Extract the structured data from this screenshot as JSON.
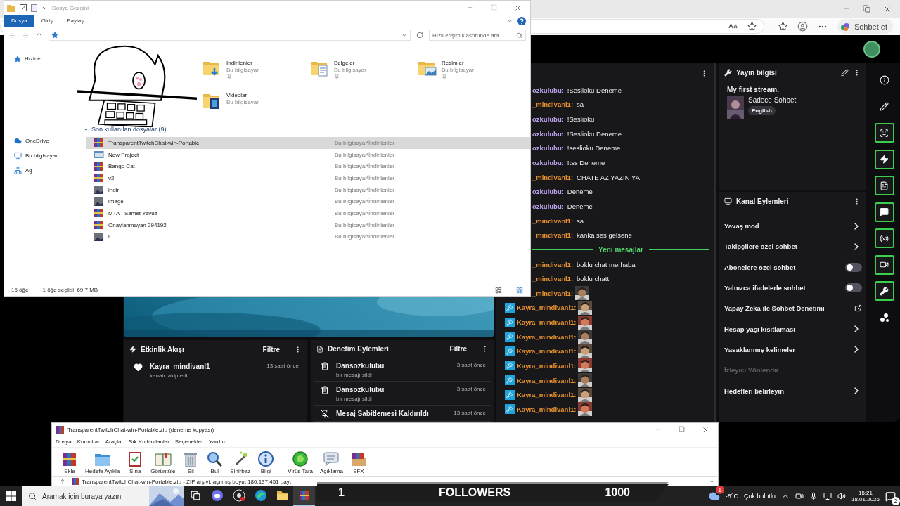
{
  "browser": {
    "copilot_button": "Sohbet et"
  },
  "twitch": {
    "chat": {
      "messages": [
        {
          "kind": "text",
          "badge": false,
          "user": "ozkulubu:",
          "text": "!Seslioku Deneme",
          "color": "#b8a0e8"
        },
        {
          "kind": "text",
          "badge": false,
          "user": "_mindivanl1:",
          "text": "sa",
          "color": "#e8912e"
        },
        {
          "kind": "text",
          "badge": false,
          "user": "ozkulubu:",
          "text": "!Seslioku",
          "color": "#b8a0e8"
        },
        {
          "kind": "text",
          "badge": false,
          "user": "ozkulubu:",
          "text": "!Seslioku Deneme",
          "color": "#b8a0e8"
        },
        {
          "kind": "text",
          "badge": false,
          "user": "ozkulubu:",
          "text": "!seslioku Deneme",
          "color": "#b8a0e8"
        },
        {
          "kind": "text",
          "badge": false,
          "user": "ozkulubu:",
          "text": "!tss Deneme",
          "color": "#b8a0e8"
        },
        {
          "kind": "text",
          "badge": false,
          "user": "_mindivanl1:",
          "text": "CHATE AZ YAZIN YA",
          "color": "#e8912e"
        },
        {
          "kind": "text",
          "badge": false,
          "user": "ozkulubu:",
          "text": "Deneme",
          "color": "#b8a0e8"
        },
        {
          "kind": "text",
          "badge": false,
          "user": "ozkulubu:",
          "text": "Deneme",
          "color": "#b8a0e8"
        },
        {
          "kind": "text",
          "badge": false,
          "user": "_mindivanl1:",
          "text": "sa",
          "color": "#e8912e"
        },
        {
          "kind": "text",
          "badge": false,
          "user": "_mindivanl1:",
          "text": "kanka ses gelsene",
          "color": "#e8912e"
        },
        {
          "kind": "divider",
          "text": "Yeni mesajlar"
        },
        {
          "kind": "text",
          "badge": false,
          "user": "_mindivanl1:",
          "text": "boklu chat merhaba",
          "color": "#e8912e"
        },
        {
          "kind": "text",
          "badge": false,
          "user": "_mindivanl1:",
          "text": "boklu chatt",
          "color": "#e8912e"
        },
        {
          "kind": "emote",
          "badge": false,
          "user": "_mindivanl1:",
          "color": "#e8912e"
        },
        {
          "kind": "emote",
          "badge": true,
          "user": "Kayra_mindivanl1:",
          "color": "#e8912e"
        },
        {
          "kind": "emote",
          "badge": true,
          "user": "Kayra_mindivanl1:",
          "color": "#e8912e"
        },
        {
          "kind": "emote",
          "badge": true,
          "user": "Kayra_mindivanl1:",
          "color": "#e8912e"
        },
        {
          "kind": "emote",
          "badge": true,
          "user": "Kayra_mindivanl1:",
          "color": "#e8912e"
        },
        {
          "kind": "emote",
          "badge": true,
          "user": "Kayra_mindivanl1:",
          "color": "#e8912e"
        },
        {
          "kind": "emote",
          "badge": true,
          "user": "Kayra_mindivanl1:",
          "color": "#e8912e"
        },
        {
          "kind": "emote",
          "badge": true,
          "user": "Kayra_mindivanl1:",
          "color": "#e8912e"
        },
        {
          "kind": "emote",
          "badge": true,
          "user": "Kayra_mindivanl1:",
          "color": "#e8912e"
        }
      ]
    },
    "stream_info": {
      "title": "Yayın bilgisi",
      "stream_title": "My first stream.",
      "category": "Sadece Sohbet",
      "tag": "English"
    },
    "channel_actions": {
      "title": "Kanal Eylemleri",
      "items": [
        {
          "label": "Yavaş mod",
          "kind": "chevron",
          "disabled": false
        },
        {
          "label": "Takipçilere özel sohbet",
          "kind": "chevron",
          "disabled": false
        },
        {
          "label": "Abonelere özel sohbet",
          "kind": "toggle",
          "on": false,
          "disabled": false
        },
        {
          "label": "Yalnızca ifadelerle sohbet",
          "kind": "toggle",
          "on": false,
          "disabled": false
        },
        {
          "label": "Yapay Zeka ile Sohbet Denetimi",
          "kind": "external",
          "disabled": false
        },
        {
          "label": "Hesap yaşı kısıtlaması",
          "kind": "chevron",
          "disabled": false
        },
        {
          "label": "Yasaklanmış kelimeler",
          "kind": "chevron",
          "disabled": false
        },
        {
          "label": "İzleyici Yönlendir",
          "kind": "plain",
          "disabled": true
        },
        {
          "label": "Hedefleri belirleyin",
          "kind": "chevron",
          "disabled": false
        }
      ]
    },
    "activity": {
      "title": "Etkinlik Akışı",
      "filter": "Filtre",
      "items": [
        {
          "kind": "follow",
          "heading": "Kayra_mindivanl1",
          "detail": "kanalı takip etti",
          "time": "13 saat önce"
        }
      ]
    },
    "moderation": {
      "title": "Denetim Eylemleri",
      "filter": "Filtre",
      "items": [
        {
          "kind": "delete",
          "heading": "Dansozkulubu",
          "detail": "bir mesajı sildi",
          "time": "3 saat önce"
        },
        {
          "kind": "delete",
          "heading": "Dansozkulubu",
          "detail": "bir mesajı sildi",
          "time": "3 saat önce"
        },
        {
          "kind": "unpin",
          "heading": "Mesaj Sabitlemesi Kaldırıldı",
          "time": "13 saat önce"
        }
      ]
    }
  },
  "explorer": {
    "title": "Dosya Gezgini",
    "ribbon_tabs": [
      {
        "label": "Dosya",
        "selected": true
      },
      {
        "label": "Giriş",
        "selected": false
      },
      {
        "label": "Paylaş",
        "selected": false
      }
    ],
    "search": {
      "placeholder": "Hızlı erişim klasöründe ara"
    },
    "nav_partial": "Hızlı e",
    "nav": [
      {
        "label": "OneDrive",
        "kind": "cloud"
      },
      {
        "label": "Bu bilgisayar",
        "kind": "pc"
      },
      {
        "label": "Ağ",
        "kind": "network"
      }
    ],
    "quick_access": [
      {
        "name": "İndirilenler",
        "location": "Bu bilgisayar",
        "kind": "downloads",
        "pinned": true
      },
      {
        "name": "Belgeler",
        "location": "Bu bilgisayar",
        "kind": "documents",
        "pinned": true
      },
      {
        "name": "Resimler",
        "location": "Bu bilgisayar",
        "kind": "pictures",
        "pinned": true
      },
      {
        "name": "Videolar",
        "location": "Bu bilgisayar",
        "kind": "videos",
        "pinned": false
      }
    ],
    "recent": {
      "title": "Son kullanılan dosyalar (9)",
      "expanded": true,
      "files": [
        {
          "name": "TransparentTwitchChat-win-Portable",
          "location": "Bu bilgisayar\\İndirilenler",
          "kind": "archive",
          "selected": true
        },
        {
          "name": "New Project",
          "location": "Bu bilgisayar\\İndirilenler",
          "kind": "project",
          "selected": false
        },
        {
          "name": "Bango Cat",
          "location": "Bu bilgisayar\\İndirilenler",
          "kind": "archive",
          "selected": false
        },
        {
          "name": "v2",
          "location": "Bu bilgisayar\\İndirilenler",
          "kind": "archive",
          "selected": false
        },
        {
          "name": "indir",
          "location": "Bu bilgisayar\\İndirilenler",
          "selected": false
        },
        {
          "name": "image",
          "location": "Bu bilgisayar\\İndirilenler",
          "selected": false
        },
        {
          "name": "MTA - Samet Yavuz",
          "location": "Bu bilgisayar\\İndirilenler",
          "kind": "archive",
          "selected": false
        },
        {
          "name": "Onaylanmayan 294192",
          "location": "Bu bilgisayar\\İndirilenler",
          "kind": "archive",
          "selected": false
        },
        {
          "name": "i",
          "location": "Bu bilgisayar\\İndirilenler",
          "selected": false
        }
      ]
    },
    "status": {
      "count": "15 öğe",
      "selection": "1 öğe seçildi  69,7 MB"
    }
  },
  "winrar": {
    "title": "TransparentTwitchChat-win-Portable.zip (deneme kopyası)",
    "menu": [
      "Dosya",
      "Komutlar",
      "Araçlar",
      "Sık Kullanılanlar",
      "Seçenekler",
      "Yardım"
    ],
    "tools": [
      {
        "label": "Ekle",
        "kind": "add"
      },
      {
        "label": "Hedefe Ayıkla",
        "kind": "extract"
      },
      {
        "label": "Sına",
        "kind": "test"
      },
      {
        "label": "Görüntüle",
        "kind": "view"
      },
      {
        "label": "Sil",
        "kind": "delete"
      },
      {
        "label": "Bul",
        "kind": "find"
      },
      {
        "label": "Sihirbaz",
        "kind": "wizard"
      },
      {
        "label": "Bilgi",
        "kind": "info"
      },
      {
        "label": "Virüs Tara",
        "kind": "scan"
      },
      {
        "label": "Açıklama",
        "kind": "comment"
      },
      {
        "label": "SFX",
        "kind": "sfx"
      }
    ],
    "path": "TransparentTwitchChat-win-Portable.zip - ZIP arşivi, açılmış boyut 180.137.451 bayt"
  },
  "followers": {
    "current": "1",
    "label": "FOLLOWERS",
    "goal": "1000"
  },
  "taskbar": {
    "search": {
      "placeholder": "Aramak için buraya yazın"
    },
    "apps": [
      {
        "kind": "taskview",
        "active": false
      },
      {
        "kind": "discord",
        "active": false
      },
      {
        "kind": "obs",
        "active": false
      },
      {
        "kind": "edge",
        "active": false
      },
      {
        "kind": "folder",
        "active": false
      },
      {
        "kind": "archive",
        "active": true
      }
    ],
    "weather": {
      "badge": "1",
      "temperature": "-8°C",
      "condition": "Çok bulutlu"
    },
    "time": "15:21",
    "date": "18.01.2026",
    "notifications": "2"
  }
}
